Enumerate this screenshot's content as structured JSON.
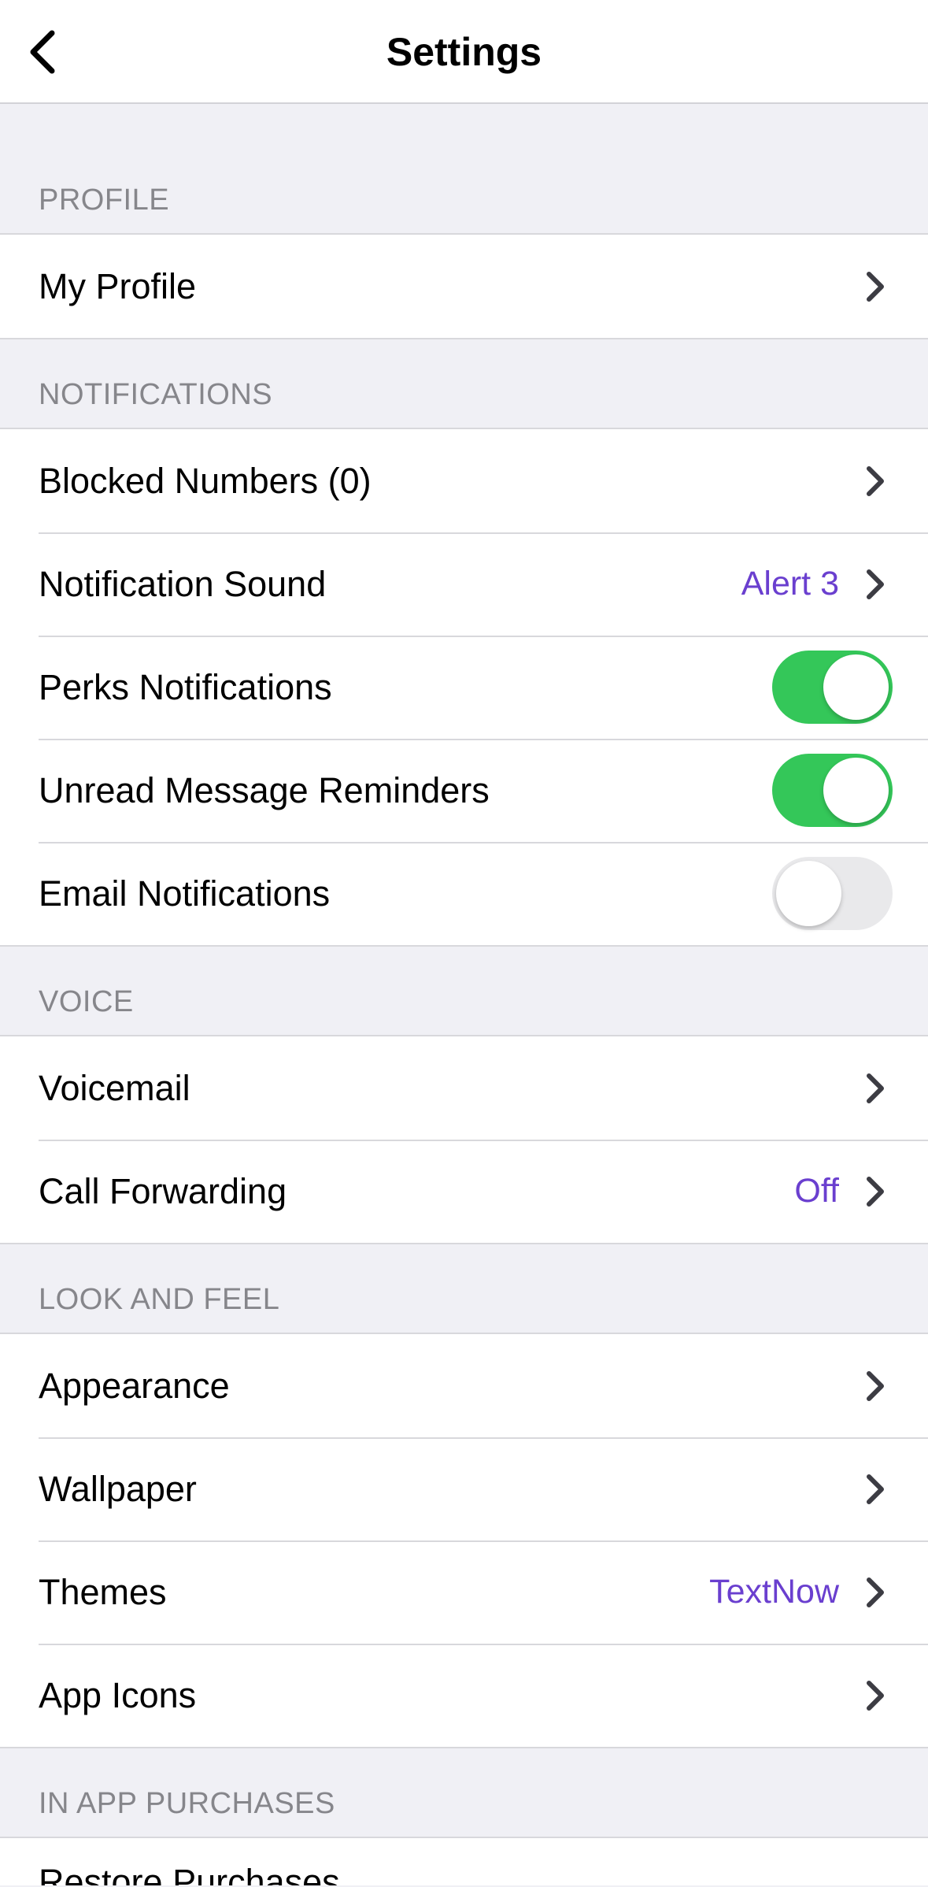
{
  "header": {
    "title": "Settings",
    "back_icon": "chevron-left-icon"
  },
  "colors": {
    "accent": "#6a3fcf",
    "toggle_on": "#34c759",
    "toggle_off": "#e9e9eb",
    "section_text": "#86868b"
  },
  "sections": {
    "profile": {
      "title": "PROFILE",
      "items": {
        "my_profile": {
          "label": "My Profile"
        }
      }
    },
    "notifications": {
      "title": "NOTIFICATIONS",
      "items": {
        "blocked_numbers": {
          "label": "Blocked Numbers (0)"
        },
        "notification_sound": {
          "label": "Notification Sound",
          "value": "Alert 3"
        },
        "perks_notifications": {
          "label": "Perks Notifications",
          "enabled": true
        },
        "unread_message_reminders": {
          "label": "Unread Message Reminders",
          "enabled": true
        },
        "email_notifications": {
          "label": "Email Notifications",
          "enabled": false
        }
      }
    },
    "voice": {
      "title": "VOICE",
      "items": {
        "voicemail": {
          "label": "Voicemail"
        },
        "call_forwarding": {
          "label": "Call Forwarding",
          "value": "Off"
        }
      }
    },
    "look_and_feel": {
      "title": "LOOK AND FEEL",
      "items": {
        "appearance": {
          "label": "Appearance"
        },
        "wallpaper": {
          "label": "Wallpaper"
        },
        "themes": {
          "label": "Themes",
          "value": "TextNow"
        },
        "app_icons": {
          "label": "App Icons"
        }
      }
    },
    "in_app_purchases": {
      "title": "IN APP PURCHASES",
      "items": {
        "restore_purchases": {
          "label": "Restore Purchases"
        }
      }
    }
  }
}
